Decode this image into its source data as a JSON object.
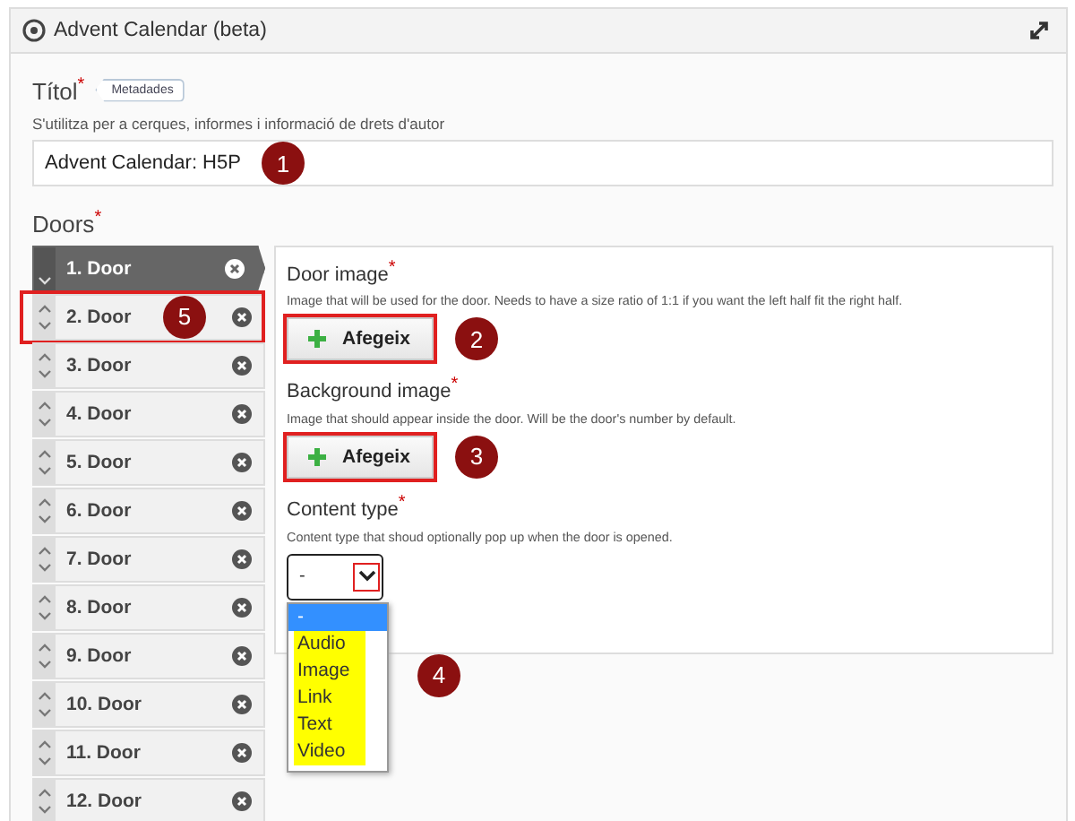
{
  "header": {
    "title": "Advent Calendar (beta)"
  },
  "title_field": {
    "label": "Títol",
    "required_mark": "*",
    "metadata_button": "Metadades",
    "description": "S'utilitza per a cerques, informes i informació de drets d'autor",
    "value": "Advent Calendar: H5P",
    "callout": "1"
  },
  "doors": {
    "label": "Doors",
    "required_mark": "*",
    "items": [
      {
        "label": "1. Door",
        "selected": true,
        "highlighted": false
      },
      {
        "label": "2. Door",
        "selected": false,
        "highlighted": true,
        "callout": "5"
      },
      {
        "label": "3. Door",
        "selected": false,
        "highlighted": false
      },
      {
        "label": "4. Door",
        "selected": false,
        "highlighted": false
      },
      {
        "label": "5. Door",
        "selected": false,
        "highlighted": false
      },
      {
        "label": "6. Door",
        "selected": false,
        "highlighted": false
      },
      {
        "label": "7. Door",
        "selected": false,
        "highlighted": false
      },
      {
        "label": "8. Door",
        "selected": false,
        "highlighted": false
      },
      {
        "label": "9. Door",
        "selected": false,
        "highlighted": false
      },
      {
        "label": "10. Door",
        "selected": false,
        "highlighted": false
      },
      {
        "label": "11. Door",
        "selected": false,
        "highlighted": false
      },
      {
        "label": "12. Door",
        "selected": false,
        "highlighted": false
      }
    ]
  },
  "fields": [
    {
      "kind": "image",
      "label": "Door image",
      "required_mark": "*",
      "description": "Image that will be used for the door. Needs to have a size ratio of 1:1 if you want the left half fit the right half.",
      "button": "Afegeix",
      "highlighted": true,
      "callout": "2"
    },
    {
      "kind": "image",
      "label": "Background image",
      "required_mark": "*",
      "description": "Image that should appear inside the door. Will be the door's number by default.",
      "button": "Afegeix",
      "highlighted": true,
      "callout": "3"
    },
    {
      "kind": "select",
      "label": "Content type",
      "required_mark": "*",
      "description": "Content type that shoud optionally pop up when the door is opened.",
      "value": "-",
      "expanded": true,
      "arrow_highlighted": true,
      "callout": "4",
      "options": [
        {
          "label": "-",
          "selected": true,
          "highlighted": false
        },
        {
          "label": "Audio",
          "selected": false,
          "highlighted": true
        },
        {
          "label": "Image",
          "selected": false,
          "highlighted": true
        },
        {
          "label": "Link",
          "selected": false,
          "highlighted": true
        },
        {
          "label": "Text",
          "selected": false,
          "highlighted": true
        },
        {
          "label": "Video",
          "selected": false,
          "highlighted": true
        }
      ]
    }
  ]
}
